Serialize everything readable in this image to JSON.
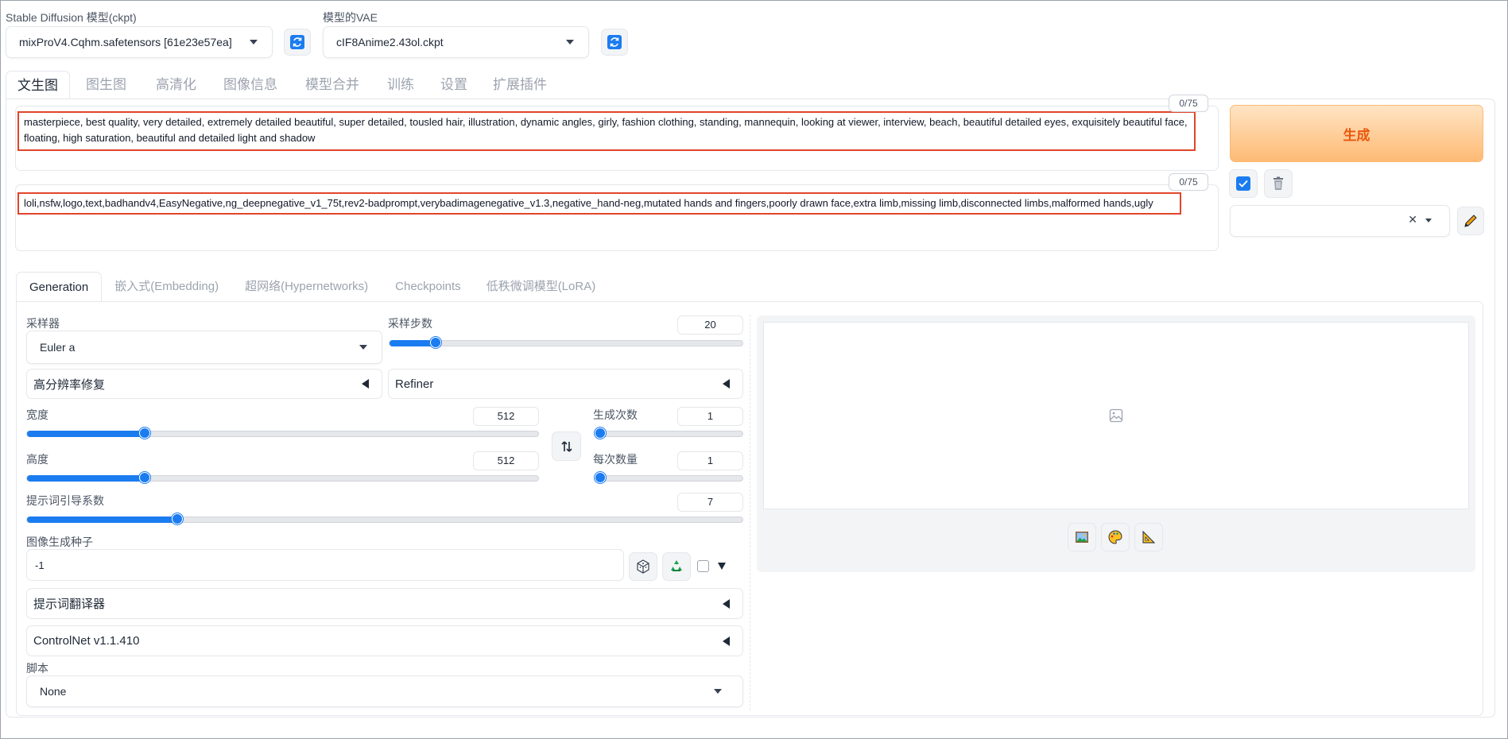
{
  "header": {
    "ckpt_label": "Stable Diffusion 模型(ckpt)",
    "ckpt_value": "mixProV4.Cqhm.safetensors [61e23e57ea]",
    "vae_label": "模型的VAE",
    "vae_value": "cIF8Anime2.43ol.ckpt"
  },
  "main_tabs": [
    "文生图",
    "图生图",
    "高清化",
    "图像信息",
    "模型合并",
    "训练",
    "设置",
    "扩展插件"
  ],
  "prompt": {
    "text": "masterpiece, best quality, very detailed, extremely detailed beautiful, super detailed, tousled hair, illustration, dynamic angles, girly, fashion clothing, standing, mannequin, looking at viewer, interview, beach, beautiful detailed eyes, exquisitely beautiful face, floating, high saturation, beautiful and detailed light and shadow",
    "counter": "0/75"
  },
  "negative_prompt": {
    "text": "loli,nsfw,logo,text,badhandv4,EasyNegative,ng_deepnegative_v1_75t,rev2-badprompt,verybadimagenegative_v1.3,negative_hand-neg,mutated hands and fingers,poorly drawn face,extra limb,missing limb,disconnected limbs,malformed hands,ugly",
    "counter": "0/75"
  },
  "generate_label": "生成",
  "sub_tabs": [
    "Generation",
    "嵌入式(Embedding)",
    "超网络(Hypernetworks)",
    "Checkpoints",
    "低秩微调模型(LoRA)"
  ],
  "sampler": {
    "label": "采样器",
    "value": "Euler a"
  },
  "steps": {
    "label": "采样步数",
    "value": "20",
    "fraction": 0.13
  },
  "hires_label": "高分辨率修复",
  "refiner_label": "Refiner",
  "width": {
    "label": "宽度",
    "value": "512",
    "fraction": 0.23
  },
  "height": {
    "label": "高度",
    "value": "512",
    "fraction": 0.23
  },
  "batch_count": {
    "label": "生成次数",
    "value": "1",
    "fraction": 0.0
  },
  "batch_size": {
    "label": "每次数量",
    "value": "1",
    "fraction": 0.0
  },
  "cfg": {
    "label": "提示词引导系数",
    "value": "7",
    "fraction": 0.21
  },
  "seed": {
    "label": "图像生成种子",
    "value": "-1"
  },
  "translator_label": "提示词翻译器",
  "controlnet_label": "ControlNet v1.1.410",
  "script": {
    "label": "脚本",
    "value": "None"
  },
  "icons": {
    "refresh": "refresh-icon",
    "swap": "swap-icon",
    "dice": "dice-icon",
    "recycle": "recycle-icon",
    "image": "image-icon",
    "palette": "palette-icon",
    "ruler": "ruler-icon",
    "trash": "trash-icon",
    "pencil": "pencil-icon",
    "check": "check-icon"
  },
  "colors": {
    "accent": "#1b7cf0",
    "generate": "#ea580c",
    "highlight": "#e1452a"
  }
}
